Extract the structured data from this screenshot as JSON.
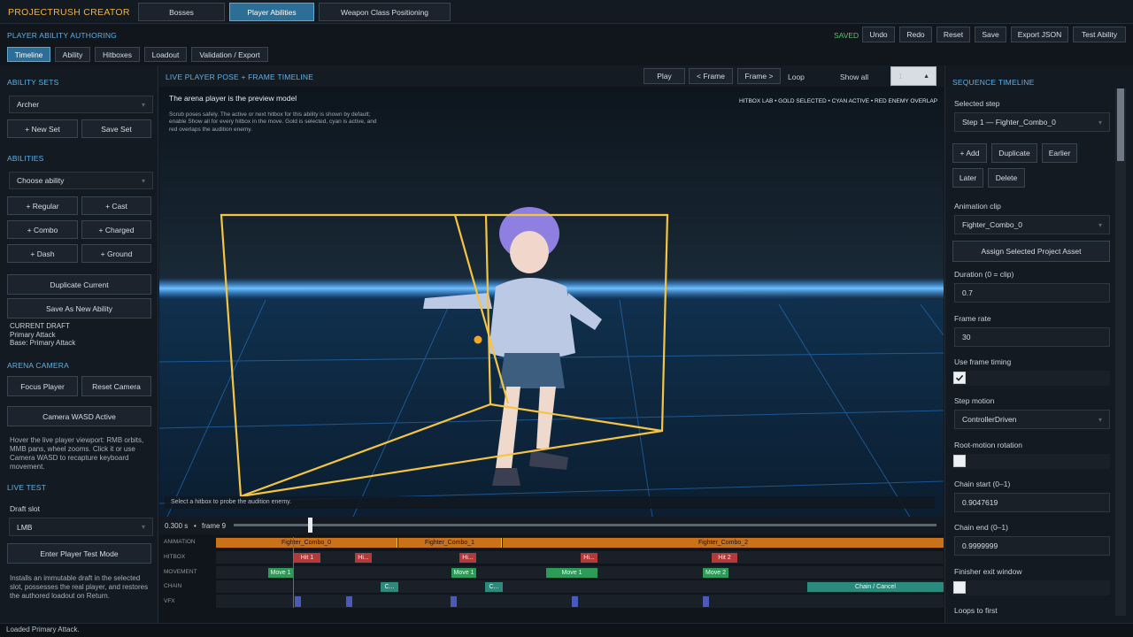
{
  "app": {
    "title": "PROJECTRUSH CREATOR",
    "tabs": [
      "Bosses",
      "Player Abilities",
      "Weapon Class Positioning"
    ],
    "active_tab": 1
  },
  "authoring": {
    "section": "PLAYER ABILITY AUTHORING",
    "status": "SAVED",
    "actions": [
      "Undo",
      "Redo",
      "Reset",
      "Save",
      "Export JSON",
      "Test Ability"
    ],
    "subtabs": [
      "Timeline",
      "Ability",
      "Hitboxes",
      "Loadout",
      "Validation / Export"
    ],
    "active_subtab": 0
  },
  "left": {
    "ability_sets": {
      "header": "ABILITY SETS",
      "selected": "Archer",
      "new_set": "+ New Set",
      "save_set": "Save Set"
    },
    "abilities": {
      "header": "ABILITIES",
      "placeholder": "Choose ability",
      "add_buttons": [
        "+ Regular",
        "+ Cast",
        "+ Combo",
        "+ Charged",
        "+ Dash",
        "+ Ground"
      ],
      "duplicate": "Duplicate Current",
      "save_new": "Save As New Ability"
    },
    "draft": {
      "label": "CURRENT DRAFT",
      "name": "Primary Attack",
      "base": "Base: Primary Attack"
    },
    "camera": {
      "header": "ARENA CAMERA",
      "focus": "Focus Player",
      "reset": "Reset Camera",
      "wasd": "Camera WASD Active",
      "help": "Hover the live player viewport: RMB orbits, MMB pans, wheel zooms. Click it or use Camera WASD to recapture keyboard movement."
    },
    "live_test": {
      "header": "LIVE TEST",
      "slot_label": "Draft slot",
      "slot_value": "LMB",
      "enter": "Enter Player Test Mode",
      "help": "Installs an immutable draft in the selected slot, possesses the real player, and restores the authored loadout on Return."
    }
  },
  "viewport": {
    "header": "LIVE PLAYER POSE + FRAME TIMELINE",
    "play": "Play",
    "prev_frame": "< Frame",
    "next_frame": "Frame >",
    "loop": "Loop",
    "show_all": "Show all",
    "show_all_value": "1",
    "preview_title": "The arena player is the preview model",
    "preview_help": "Scrub poses safely. The active or next hitbox for this ability is shown by default; enable Show all for every hitbox in the move. Gold is selected, cyan is active, and red overlaps the audition enemy.",
    "legend": "HITBOX LAB  •  GOLD SELECTED  •  CYAN ACTIVE  •  RED ENEMY OVERLAP",
    "probe_hint": "Select a hitbox to probe the audition enemy.",
    "time": "0.300 s",
    "frame": "frame 9",
    "scrub_fraction": 0.108,
    "colors": {
      "selected": "#f5c542",
      "active": "#3fd0e8",
      "overlap": "#c0392b",
      "floor_glow": "#2a8cff"
    }
  },
  "tracks": {
    "labels": [
      "ANIMATION",
      "HITBOX",
      "MOVEMENT",
      "CHAIN",
      "VFX"
    ],
    "animation": [
      "Fighter_Combo_0",
      "Fighter_Combo_1",
      "Fighter_Combo_2"
    ],
    "hitbox": [
      "Hit 1",
      "Hi...",
      "Hi...",
      "Hi...",
      "Hit 2"
    ],
    "movement": [
      "Move 1",
      "Move 1",
      "Move 1",
      "Move 2"
    ],
    "chain": [
      "C...",
      "C...",
      "Chain / Cancel"
    ]
  },
  "right": {
    "header": "SEQUENCE TIMELINE",
    "selected_step_label": "Selected step",
    "selected_step": "Step 1 — Fighter_Combo_0",
    "step_buttons": [
      "+ Add",
      "Duplicate",
      "Earlier",
      "Later",
      "Delete"
    ],
    "anim_clip_label": "Animation clip",
    "anim_clip": "Fighter_Combo_0",
    "assign": "Assign Selected Project Asset",
    "duration_label": "Duration (0 = clip)",
    "duration": "0.7",
    "frame_rate_label": "Frame rate",
    "frame_rate": "30",
    "use_frame_timing_label": "Use frame timing",
    "use_frame_timing": true,
    "step_motion_label": "Step motion",
    "step_motion": "ControllerDriven",
    "root_motion_label": "Root-motion rotation",
    "root_motion": false,
    "chain_start_label": "Chain start (0–1)",
    "chain_start": "0.9047619",
    "chain_end_label": "Chain end (0–1)",
    "chain_end": "0.9999999",
    "finisher_label": "Finisher exit window",
    "finisher": false,
    "loops_label": "Loops to first"
  },
  "status_bar": "Loaded Primary Attack."
}
